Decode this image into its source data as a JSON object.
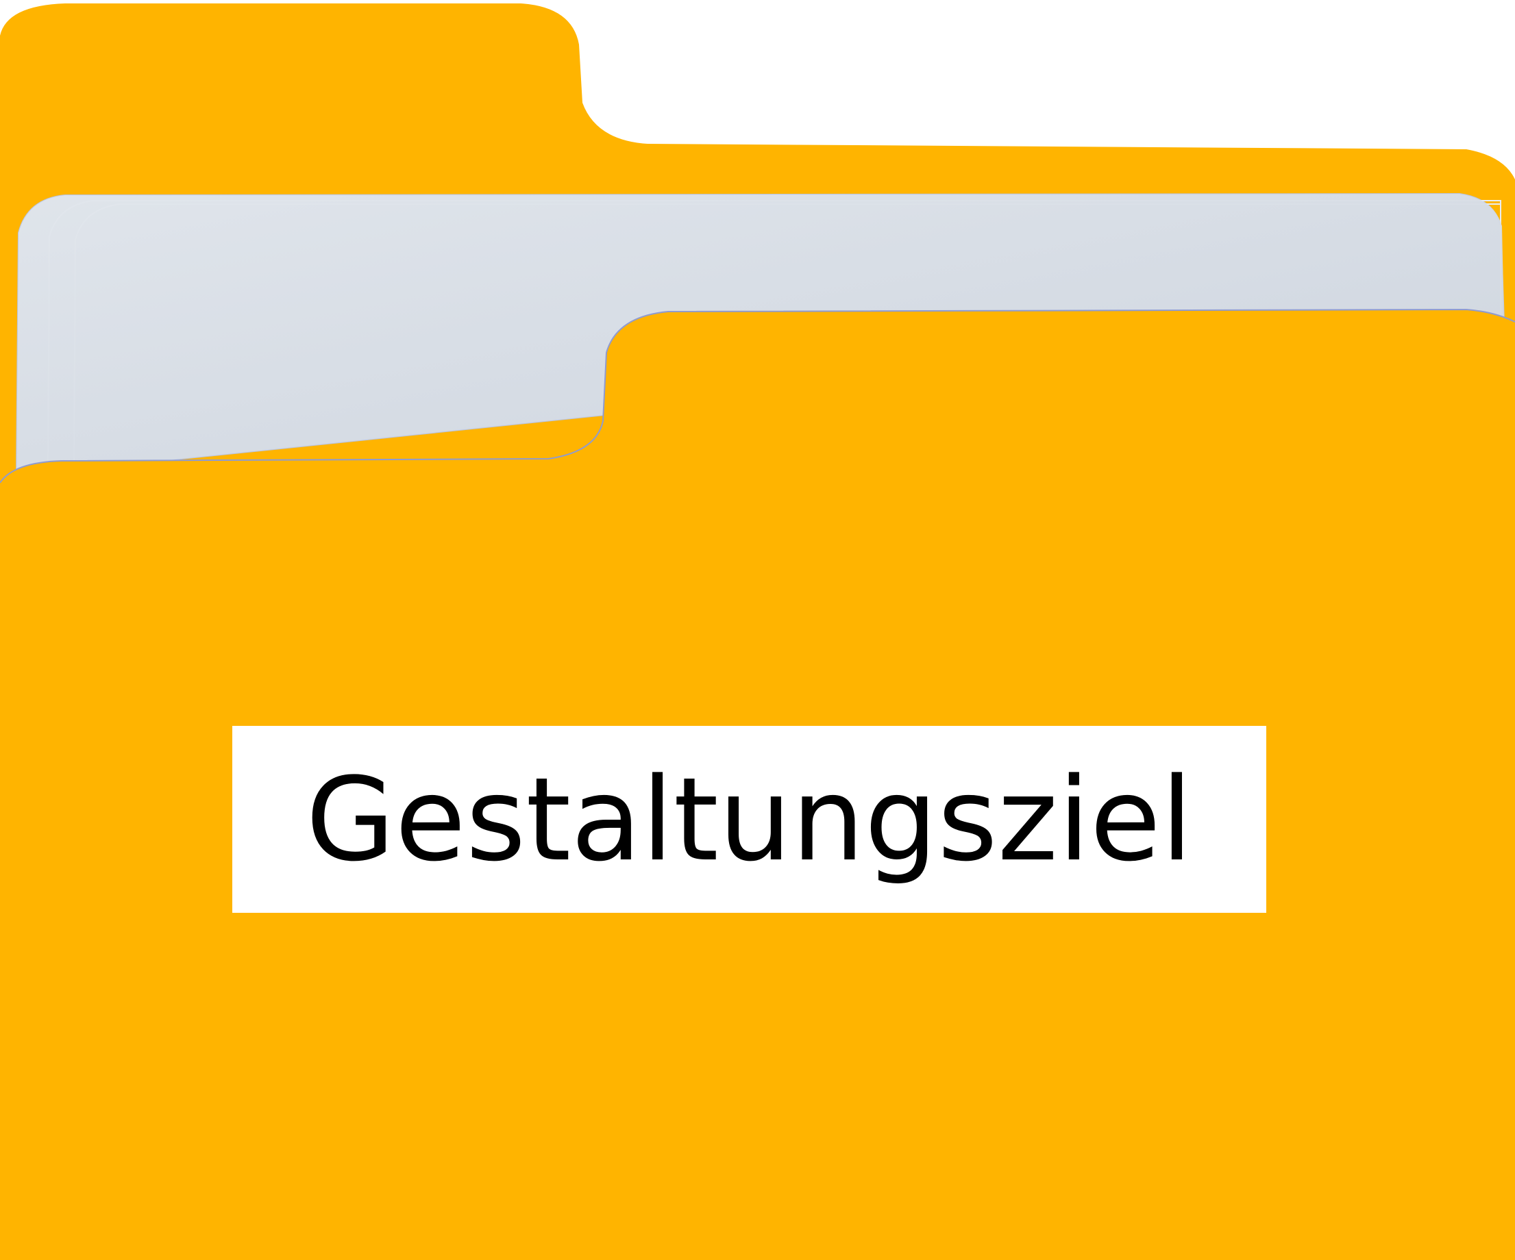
{
  "folder": {
    "label": "Gestaltungsziel",
    "colors": {
      "folder_body": "#FFB400",
      "paper": "#DADFE6",
      "paper_edge": "#B9C3DE",
      "label_background": "#FFFFFF",
      "label_text": "#000000"
    },
    "icon": "folder-with-documents-icon"
  }
}
